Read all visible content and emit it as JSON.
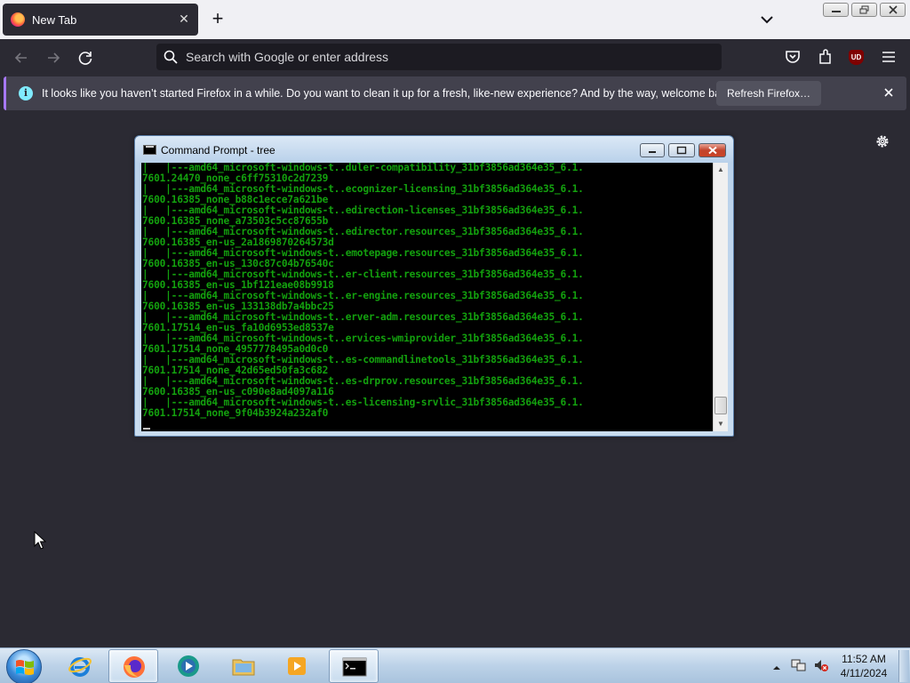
{
  "browser": {
    "tab": {
      "title": "New Tab"
    },
    "urlbar": {
      "placeholder": "Search with Google or enter address"
    },
    "notification": {
      "text": "It looks like you haven’t started Firefox in a while. Do you want to clean it up for a fresh, like-new experience? And by the way, welcome back!",
      "button_label": "Refresh Firefox…"
    },
    "extension_badge": "UD"
  },
  "cmd_window": {
    "title": "Command Prompt - tree",
    "lines": [
      "|   |---amd64_microsoft-windows-t..duler-compatibility_31bf3856ad364e35_6.1.",
      "7601.24470_none_c6ff75310c2d7239",
      "|   |---amd64_microsoft-windows-t..ecognizer-licensing_31bf3856ad364e35_6.1.",
      "7600.16385_none_b88c1ecce7a621be",
      "|   |---amd64_microsoft-windows-t..edirection-licenses_31bf3856ad364e35_6.1.",
      "7600.16385_none_a73503c5cc87655b",
      "|   |---amd64_microsoft-windows-t..edirector.resources_31bf3856ad364e35_6.1.",
      "7600.16385_en-us_2a1869870264573d",
      "|   |---amd64_microsoft-windows-t..emotepage.resources_31bf3856ad364e35_6.1.",
      "7600.16385_en-us_130c87c04b76540c",
      "|   |---amd64_microsoft-windows-t..er-client.resources_31bf3856ad364e35_6.1.",
      "7600.16385_en-us_1bf121eae08b9918",
      "|   |---amd64_microsoft-windows-t..er-engine.resources_31bf3856ad364e35_6.1.",
      "7600.16385_en-us_133138db7a4bbc25",
      "|   |---amd64_microsoft-windows-t..erver-adm.resources_31bf3856ad364e35_6.1.",
      "7601.17514_en-us_fa10d6953ed8537e",
      "|   |---amd64_microsoft-windows-t..ervices-wmiprovider_31bf3856ad364e35_6.1.",
      "7601.17514_none_4957778495a0d0c0",
      "|   |---amd64_microsoft-windows-t..es-commandlinetools_31bf3856ad364e35_6.1.",
      "7601.17514_none_42d65ed50fa3c682",
      "|   |---amd64_microsoft-windows-t..es-drprov.resources_31bf3856ad364e35_6.1.",
      "7600.16385_en-us_c090e8ad4097a116",
      "|   |---amd64_microsoft-windows-t..es-licensing-srvlic_31bf3856ad364e35_6.1.",
      "7601.17514_none_9f04b3924a232af0"
    ]
  },
  "taskbar": {
    "clock_time": "11:52 AM",
    "clock_date": "4/11/2024"
  },
  "colors": {
    "console_text": "#13a10e",
    "firefox_bg": "#2b2a33",
    "infobar_bg": "#42414d"
  }
}
